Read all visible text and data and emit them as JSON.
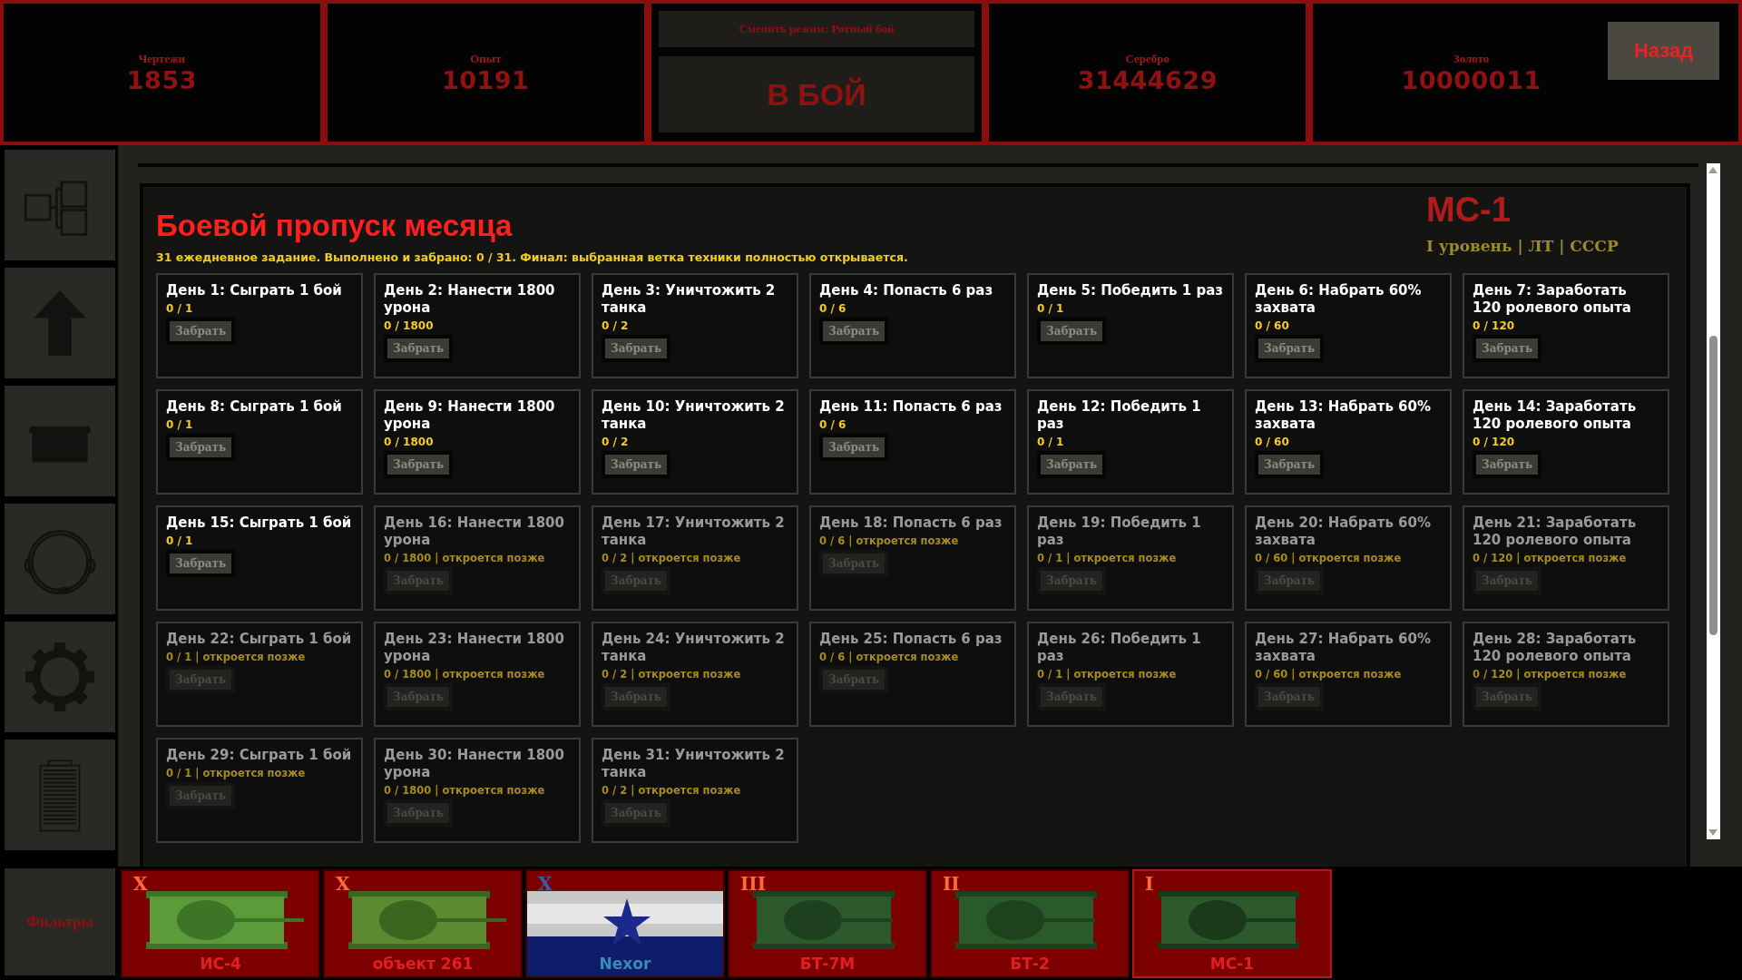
{
  "top_panels": [
    {
      "kind": "resource",
      "label": "Чертежи",
      "value": "1853"
    },
    {
      "kind": "resource",
      "label": "Опыт",
      "value": "10191"
    },
    {
      "kind": "battle",
      "mode_button": "Сменить режим: Ротный бой",
      "fight_button": "В БОЙ"
    },
    {
      "kind": "resource",
      "label": "Серебро",
      "value": "31444629"
    },
    {
      "kind": "resource",
      "label": "Золото",
      "value": "10000011"
    }
  ],
  "back_button": "Назад",
  "filters_button": "Фильтры",
  "background_panel": {
    "title": "МС-1",
    "subtitle": "I уровень | ЛТ | СССР"
  },
  "pass": {
    "title": "Боевой пропуск месяца",
    "summary": "31 ежедневное задание. Выполнено и забрано: 0 / 31. Финал: выбранная ветка техники полностью открывается.",
    "tasks": [
      {
        "title": "День 1: Сыграть 1 бой",
        "progress": "0 / 1",
        "button": "Забрать",
        "locked": false
      },
      {
        "title": "День 2: Нанести 1800 урона",
        "progress": "0 / 1800",
        "button": "Забрать",
        "locked": false
      },
      {
        "title": "День 3: Уничтожить 2 танка",
        "progress": "0 / 2",
        "button": "Забрать",
        "locked": false
      },
      {
        "title": "День 4: Попасть 6 раз",
        "progress": "0 / 6",
        "button": "Забрать",
        "locked": false
      },
      {
        "title": "День 5: Победить 1 раз",
        "progress": "0 / 1",
        "button": "Забрать",
        "locked": false
      },
      {
        "title": "День 6: Набрать 60% захвата",
        "progress": "0 / 60",
        "button": "Забрать",
        "locked": false
      },
      {
        "title": "День 7: Заработать 120 ролевого опыта",
        "progress": "0 / 120",
        "button": "Забрать",
        "locked": false
      },
      {
        "title": "День 8: Сыграть 1 бой",
        "progress": "0 / 1",
        "button": "Забрать",
        "locked": false
      },
      {
        "title": "День 9: Нанести 1800 урона",
        "progress": "0 / 1800",
        "button": "Забрать",
        "locked": false
      },
      {
        "title": "День 10: Уничтожить 2 танка",
        "progress": "0 / 2",
        "button": "Забрать",
        "locked": false
      },
      {
        "title": "День 11: Попасть 6 раз",
        "progress": "0 / 6",
        "button": "Забрать",
        "locked": false
      },
      {
        "title": "День 12: Победить 1 раз",
        "progress": "0 / 1",
        "button": "Забрать",
        "locked": false
      },
      {
        "title": "День 13: Набрать 60% захвата",
        "progress": "0 / 60",
        "button": "Забрать",
        "locked": false
      },
      {
        "title": "День 14: Заработать 120 ролевого опыта",
        "progress": "0 / 120",
        "button": "Забрать",
        "locked": false
      },
      {
        "title": "День 15: Сыграть 1 бой",
        "progress": "0 / 1",
        "button": "Забрать",
        "locked": false
      },
      {
        "title": "День 16: Нанести 1800 урона",
        "progress": "0 / 1800 | откроется позже",
        "button": "Забрать",
        "locked": true
      },
      {
        "title": "День 17: Уничтожить 2 танка",
        "progress": "0 / 2 | откроется позже",
        "button": "Забрать",
        "locked": true
      },
      {
        "title": "День 18: Попасть 6 раз",
        "progress": "0 / 6 | откроется позже",
        "button": "Забрать",
        "locked": true
      },
      {
        "title": "День 19: Победить 1 раз",
        "progress": "0 / 1 | откроется позже",
        "button": "Забрать",
        "locked": true
      },
      {
        "title": "День 20: Набрать 60% захвата",
        "progress": "0 / 60 | откроется позже",
        "button": "Забрать",
        "locked": true
      },
      {
        "title": "День 21: Заработать 120 ролевого опыта",
        "progress": "0 / 120 | откроется позже",
        "button": "Забрать",
        "locked": true
      },
      {
        "title": "День 22: Сыграть 1 бой",
        "progress": "0 / 1 | откроется позже",
        "button": "Забрать",
        "locked": true
      },
      {
        "title": "День 23: Нанести 1800 урона",
        "progress": "0 / 1800 | откроется позже",
        "button": "Забрать",
        "locked": true
      },
      {
        "title": "День 24: Уничтожить 2 танка",
        "progress": "0 / 2 | откроется позже",
        "button": "Забрать",
        "locked": true
      },
      {
        "title": "День 25: Попасть 6 раз",
        "progress": "0 / 6 | откроется позже",
        "button": "Забрать",
        "locked": true
      },
      {
        "title": "День 26: Победить 1 раз",
        "progress": "0 / 1 | откроется позже",
        "button": "Забрать",
        "locked": true
      },
      {
        "title": "День 27: Набрать 60% захвата",
        "progress": "0 / 60 | откроется позже",
        "button": "Забрать",
        "locked": true
      },
      {
        "title": "День 28: Заработать 120 ролевого опыта",
        "progress": "0 / 120 | откроется позже",
        "button": "Забрать",
        "locked": true
      },
      {
        "title": "День 29: Сыграть 1 бой",
        "progress": "0 / 1 | откроется позже",
        "button": "Забрать",
        "locked": true
      },
      {
        "title": "День 30: Нанести 1800 урона",
        "progress": "0 / 1800 | откроется позже",
        "button": "Забрать",
        "locked": true
      },
      {
        "title": "День 31: Уничтожить 2 танка",
        "progress": "0 / 2 | откроется позже",
        "button": "Забрать",
        "locked": true
      }
    ]
  },
  "tanks": [
    {
      "kind": "tank",
      "tier": "X",
      "name": "ИС-4",
      "selected": false
    },
    {
      "kind": "tank",
      "tier": "X",
      "name": "объект 261",
      "selected": false
    },
    {
      "kind": "flag",
      "tier": "X",
      "name": "Nexor",
      "selected": false
    },
    {
      "kind": "tank",
      "tier": "III",
      "name": "БТ-7М",
      "selected": false
    },
    {
      "kind": "tank",
      "tier": "II",
      "name": "БТ-2",
      "selected": false
    },
    {
      "kind": "tank",
      "tier": "I",
      "name": "МС-1",
      "selected": true
    }
  ]
}
